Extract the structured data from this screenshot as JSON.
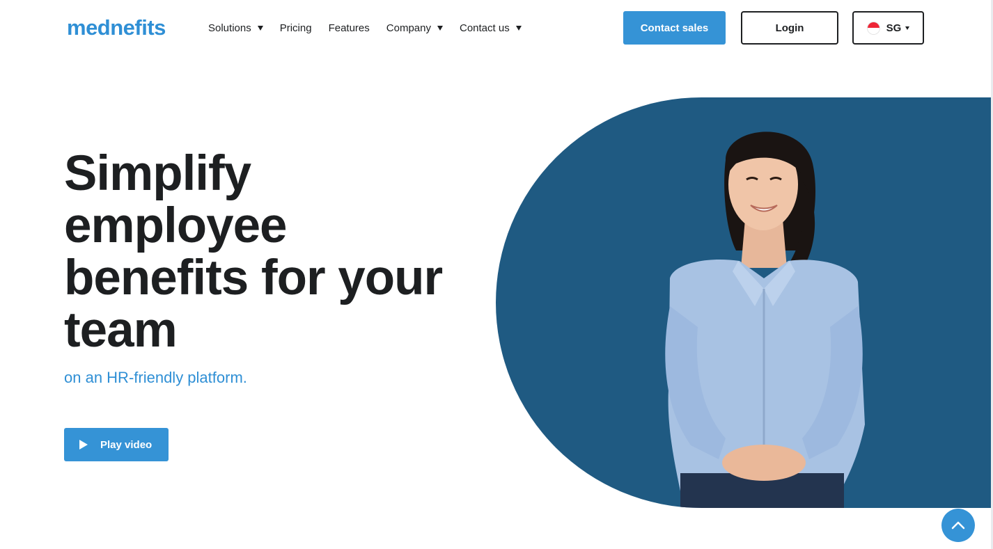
{
  "brand": {
    "logo_text": "mednefits",
    "accent_color": "#3593d6",
    "dark_color": "#1d1f21",
    "hero_bg_color": "#1f5a82"
  },
  "nav": {
    "items": [
      {
        "label": "Solutions",
        "has_dropdown": true
      },
      {
        "label": "Pricing",
        "has_dropdown": false
      },
      {
        "label": "Features",
        "has_dropdown": false
      },
      {
        "label": "Company",
        "has_dropdown": true
      },
      {
        "label": "Contact us",
        "has_dropdown": true
      }
    ]
  },
  "header_actions": {
    "contact_sales_label": "Contact sales",
    "login_label": "Login",
    "region": {
      "label": "SG",
      "flag_icon": "singapore-flag-icon"
    }
  },
  "hero": {
    "title": "Simplify employee benefits for your team",
    "subtitle": "on an HR-friendly platform.",
    "play_video_label": "Play video",
    "image_icon": "smiling-woman-photo"
  },
  "scroll_top_icon": "chevron-up-icon"
}
